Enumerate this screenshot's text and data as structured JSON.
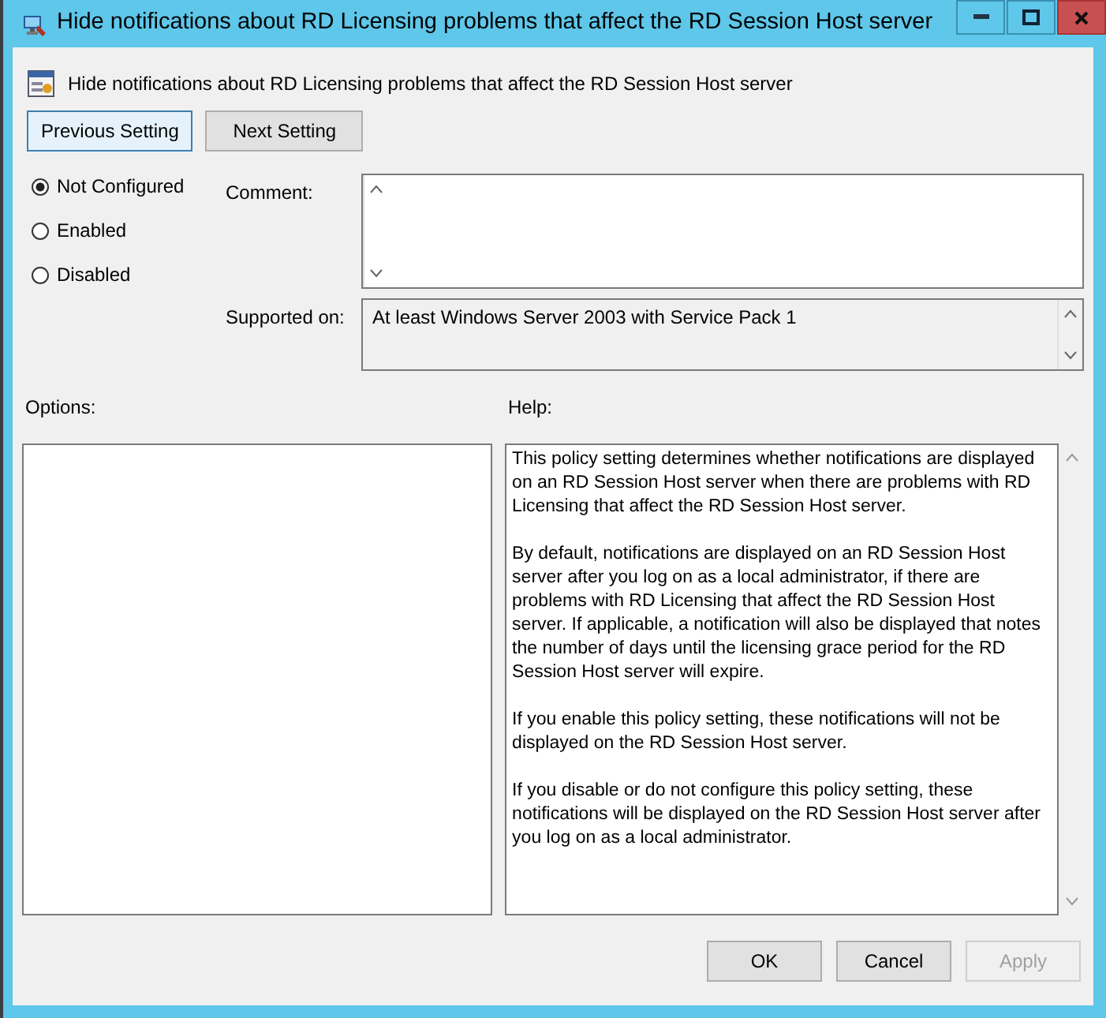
{
  "window": {
    "title": "Hide notifications about RD Licensing problems that affect the RD Session Host server"
  },
  "heading": "Hide notifications about RD Licensing problems that affect the RD Session Host server",
  "nav_buttons": [
    {
      "label": "Previous Setting",
      "focused": true
    },
    {
      "label": "Next Setting",
      "focused": false
    }
  ],
  "state_options": [
    {
      "label": "Not Configured",
      "selected": true
    },
    {
      "label": "Enabled",
      "selected": false
    },
    {
      "label": "Disabled",
      "selected": false
    }
  ],
  "comment": {
    "label": "Comment:"
  },
  "supported": {
    "label": "Supported on:",
    "value": "At least Windows Server 2003 with Service Pack 1"
  },
  "options": {
    "label": "Options:"
  },
  "help": {
    "label": "Help:",
    "paragraphs": [
      "This policy setting determines whether notifications are displayed on an RD Session Host server when there are problems with RD Licensing that affect the RD Session Host server.",
      "By default, notifications are displayed on an RD Session Host server after you log on as a local administrator, if there are problems with RD Licensing that affect the RD Session Host server. If applicable, a notification will also be displayed that notes the number of days until the licensing grace period for the RD Session Host server will expire.",
      "If you enable this policy setting, these notifications will not be displayed on the RD Session Host server.",
      "If you disable or do not configure this policy setting, these notifications will be displayed on the RD Session Host server after you log on as a local administrator."
    ]
  },
  "buttons": [
    {
      "label": "OK",
      "disabled": false
    },
    {
      "label": "Cancel",
      "disabled": false
    },
    {
      "label": "Apply",
      "disabled": true
    }
  ]
}
